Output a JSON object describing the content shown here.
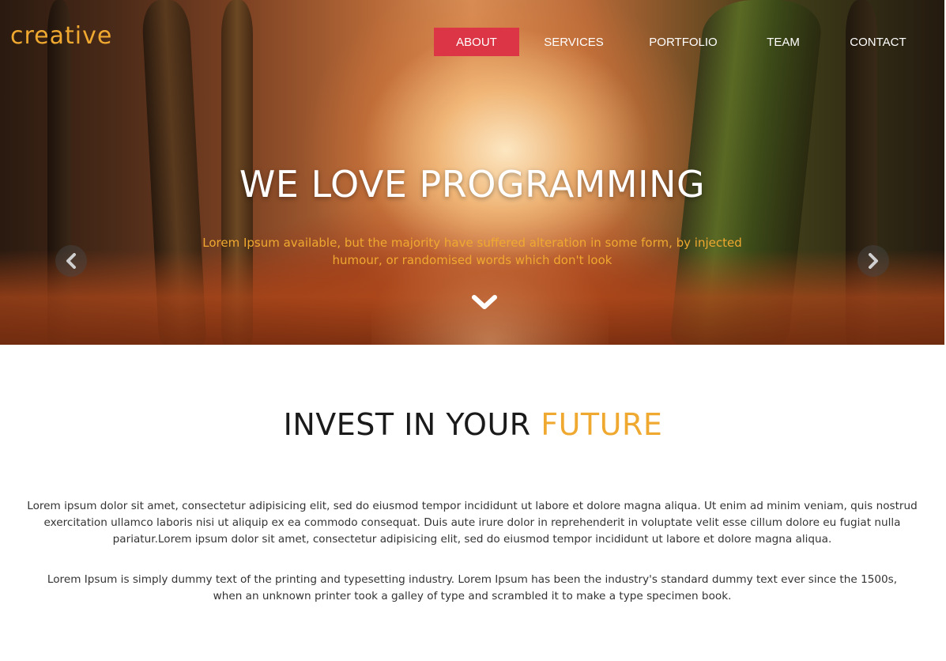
{
  "brand": {
    "logo_text": "creative"
  },
  "nav": {
    "items": [
      {
        "label": "ABOUT",
        "active": true
      },
      {
        "label": "SERVICES",
        "active": false
      },
      {
        "label": "PORTFOLIO",
        "active": false
      },
      {
        "label": "TEAM",
        "active": false
      },
      {
        "label": "CONTACT",
        "active": false
      }
    ]
  },
  "hero": {
    "title": "WE LOVE PROGRAMMING",
    "subtitle": "Lorem Ipsum available, but the majority have suffered alteration in some form, by injected humour, or randomised words which don't look",
    "prev_icon": "chevron-left-icon",
    "next_icon": "chevron-right-icon",
    "scroll_icon": "chevron-down-icon"
  },
  "about": {
    "title_main": "INVEST IN YOUR ",
    "title_accent": "FUTURE",
    "paragraph_1": "Lorem ipsum dolor sit amet, consectetur adipisicing elit, sed do eiusmod tempor incididunt ut labore et dolore magna aliqua. Ut enim ad minim veniam, quis nostrud exercitation ullamco laboris nisi ut aliquip ex ea commodo consequat. Duis aute irure dolor in reprehenderit in voluptate velit esse cillum dolore eu fugiat nulla pariatur.Lorem ipsum dolor sit amet, consectetur adipisicing elit, sed do eiusmod tempor incididunt ut labore et dolore magna aliqua.",
    "paragraph_2": "Lorem Ipsum is simply dummy text of the printing and typesetting industry. Lorem Ipsum has been the industry's standard dummy text ever since the 1500s, when an unknown printer took a galley of type and scrambled it to make a type specimen book."
  },
  "colors": {
    "accent": "#f0a930",
    "nav_active": "#dc3545",
    "heading": "#1a1a1a",
    "body_text": "#333333"
  }
}
